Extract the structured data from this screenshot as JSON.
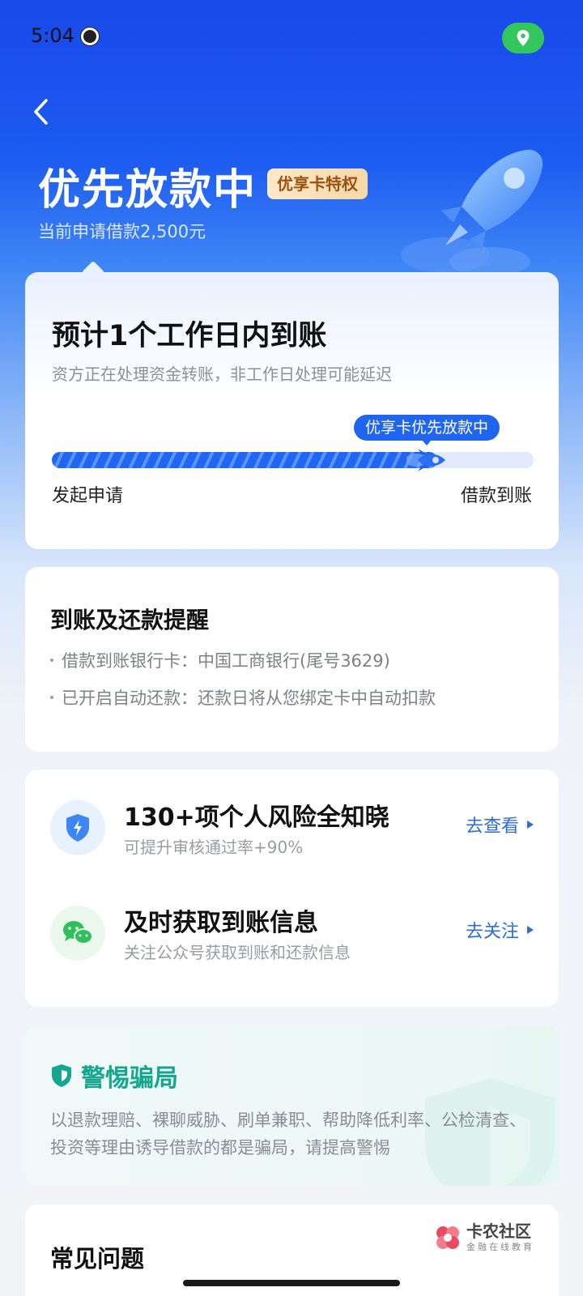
{
  "status_bar": {
    "time": "5:04"
  },
  "header": {
    "title": "优先放款中",
    "badge": "优享卡特权",
    "subtitle": "当前申请借款2,500元"
  },
  "progress_card": {
    "title": "预计1个工作日内到账",
    "description": "资方正在处理资金转账，非工作日处理可能延迟",
    "tooltip": "优享卡优先放款中",
    "start_label": "发起申请",
    "end_label": "借款到账",
    "progress_fraction": 0.8
  },
  "remind_card": {
    "title": "到账及还款提醒",
    "lines": [
      "借款到账银行卡：中国工商银行(尾号3629)",
      "已开启自动还款：还款日将从您绑定卡中自动扣款"
    ]
  },
  "services": [
    {
      "title": "130+项个人风险全知晓",
      "subtitle": "可提升审核通过率+90%",
      "link": "去查看",
      "icon": "shield-bolt-icon"
    },
    {
      "title": "及时获取到账信息",
      "subtitle": "关注公众号获取到账和还款信息",
      "link": "去关注",
      "icon": "wechat-icon"
    }
  ],
  "fraud_card": {
    "title": "警惕骗局",
    "text": "以退款理赔、裸聊威胁、刷单兼职、帮助降低利率、公检清查、投资等理由诱导借款的都是骗局，请提高警惕"
  },
  "faq": {
    "title": "常见问题"
  },
  "watermark": {
    "name": "卡农社区",
    "sub": "金融在线教育"
  },
  "colors": {
    "primary": "#1f66f2",
    "fraud_green": "#14a68e",
    "badge_text": "#9a5411"
  }
}
